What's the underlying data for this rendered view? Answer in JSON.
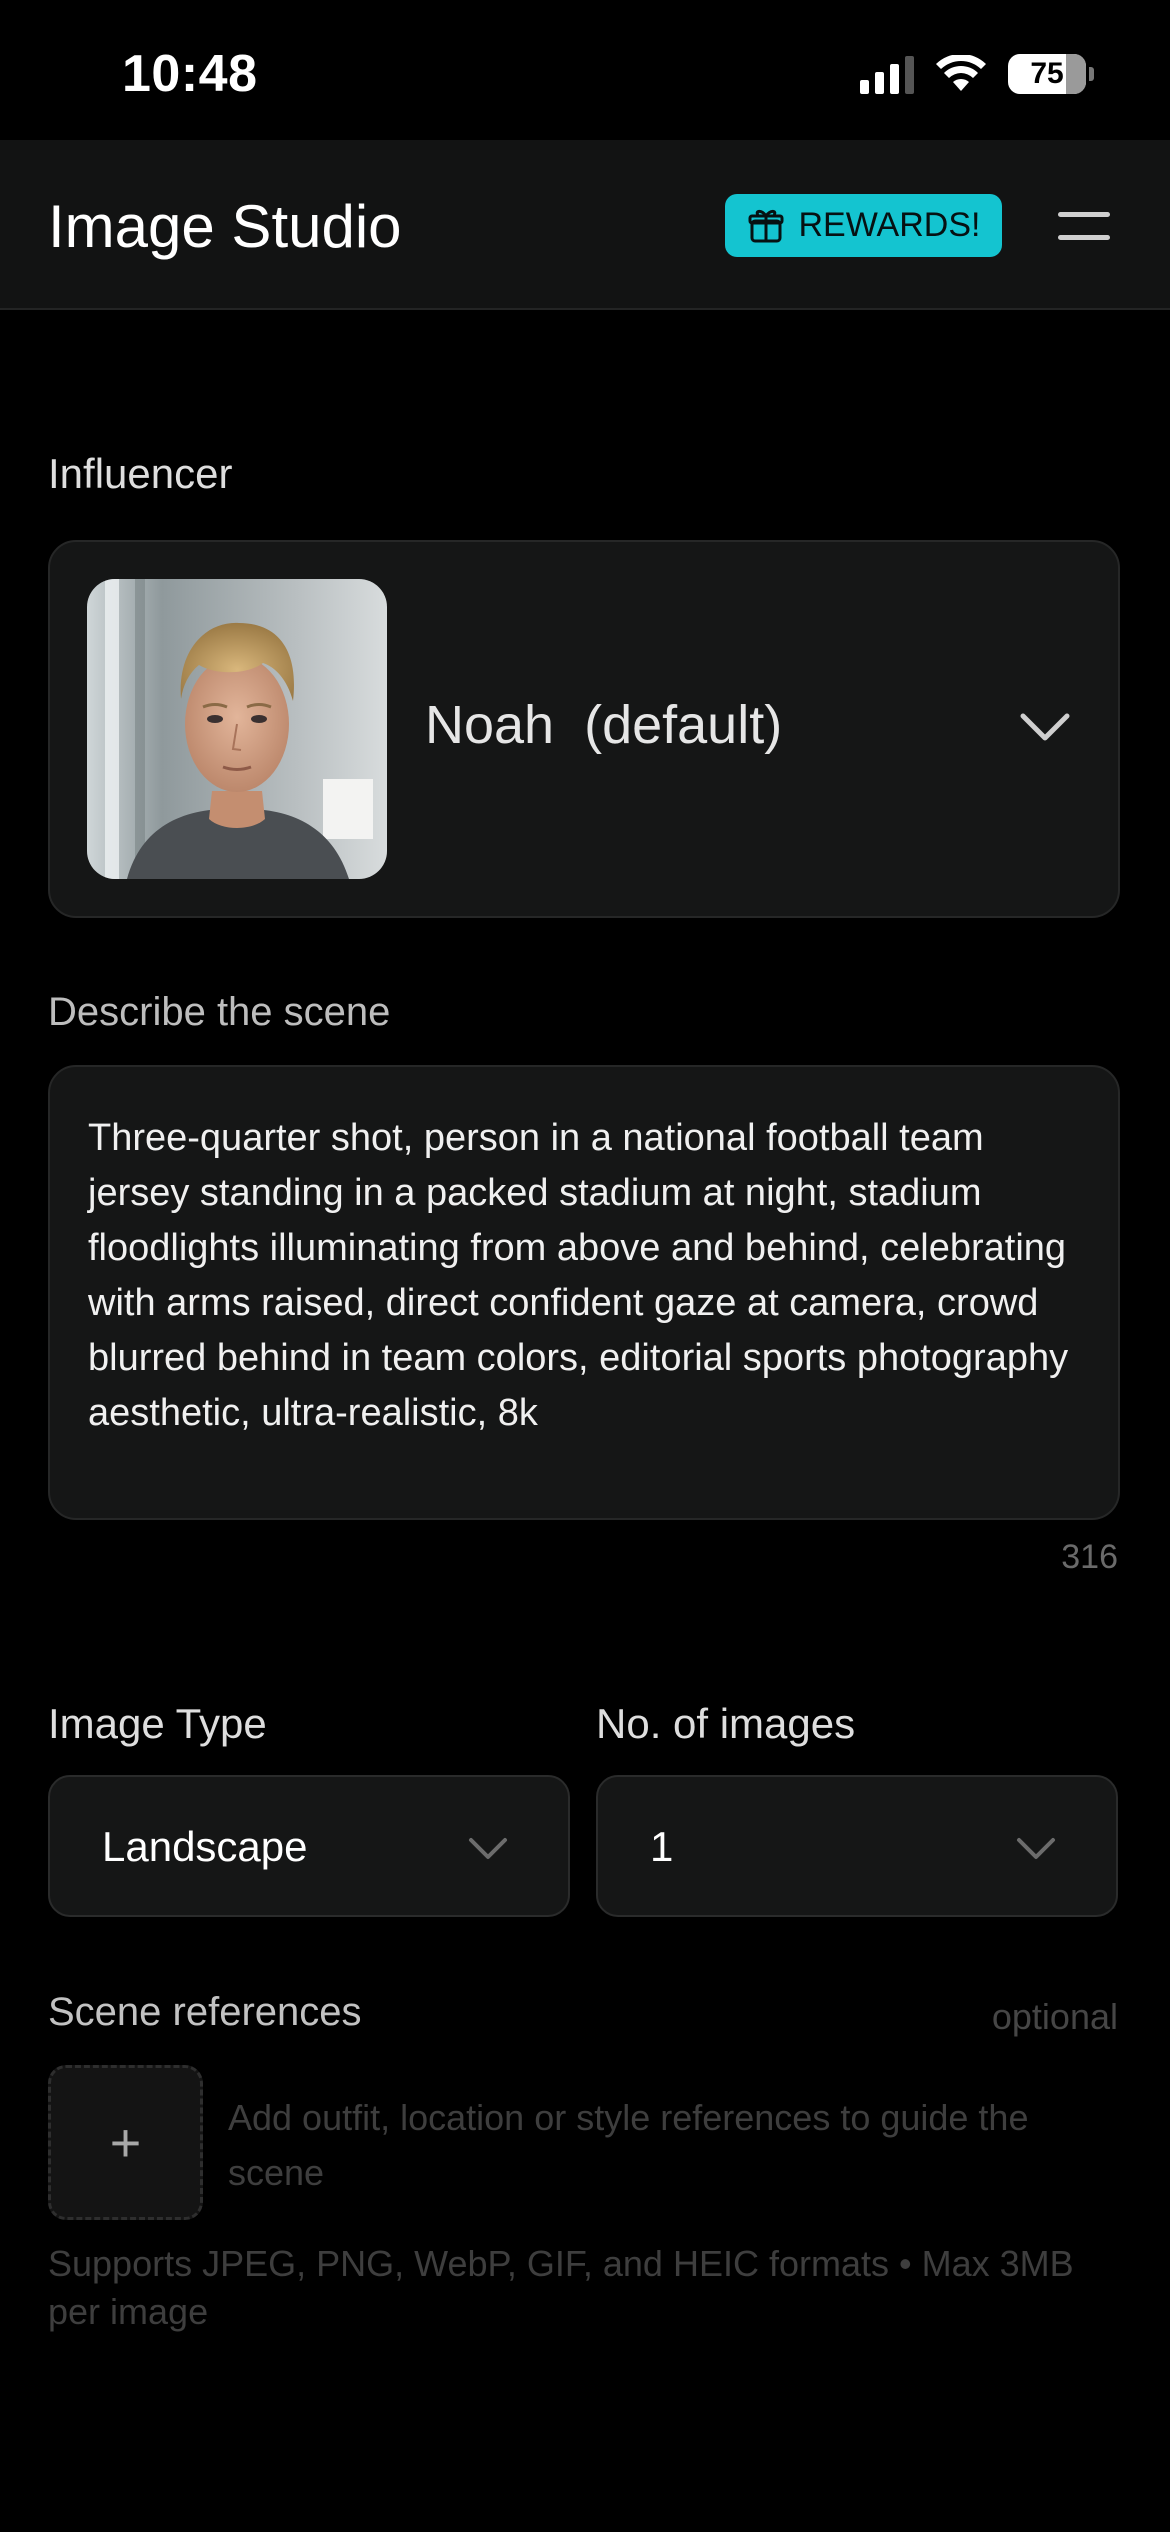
{
  "status_bar": {
    "time": "10:48",
    "battery": "75"
  },
  "header": {
    "title": "Image Studio",
    "rewards_label": "REWARDS!",
    "accent_color": "#14c4d0"
  },
  "influencer": {
    "section_label": "Influencer",
    "selected_name": "Noah  (default)",
    "avatar_icon": "portrait-photo"
  },
  "scene": {
    "section_label": "Describe the scene",
    "prompt": "Three-quarter shot, person in a national football team jersey standing in a packed stadium at night, stadium floodlights illuminating from above and behind, celebrating with arms raised, direct confident gaze at camera, crowd blurred behind in team colors, editorial sports photography aesthetic, ultra-realistic, 8k",
    "char_count": "316"
  },
  "image_type": {
    "label": "Image Type",
    "value": "Landscape"
  },
  "num_images": {
    "label": "No. of images",
    "value": "1"
  },
  "references": {
    "label": "Scene references",
    "optional": "optional",
    "add_symbol": "+",
    "hint": "Add outfit, location or style references to guide the scene",
    "formats": "Supports JPEG, PNG, WebP, GIF, and HEIC formats • Max 3MB per image"
  }
}
